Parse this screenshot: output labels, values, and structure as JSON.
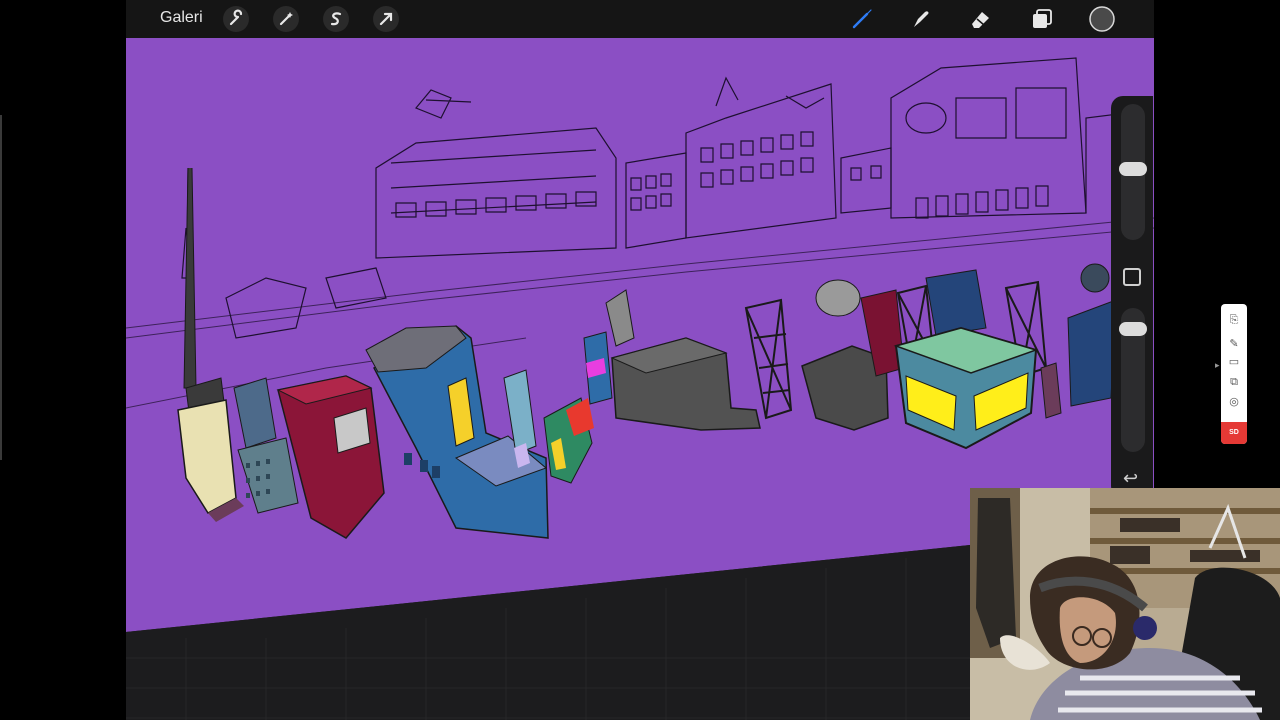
{
  "toolbar": {
    "gallery_label": "Galeri",
    "left_tools": [
      {
        "name": "actions",
        "icon": "wrench-icon"
      },
      {
        "name": "adjustments",
        "icon": "magic-wand-icon"
      },
      {
        "name": "selection",
        "icon": "selection-s-icon"
      },
      {
        "name": "transform",
        "icon": "arrow-cursor-icon"
      }
    ],
    "right_tools": [
      {
        "name": "brush",
        "icon": "brush-icon",
        "active": true
      },
      {
        "name": "smudge",
        "icon": "smudge-icon"
      },
      {
        "name": "eraser",
        "icon": "eraser-icon"
      },
      {
        "name": "layers",
        "icon": "layers-icon"
      },
      {
        "name": "color",
        "icon": "color-swatch-icon"
      }
    ],
    "accent_color": "#2e7cf6",
    "active_color": "#4a4a4a"
  },
  "canvas": {
    "background_color": "#8b4fc4",
    "floor_color": "#1c1c1e"
  },
  "sidebar": {
    "brush_size": 0.55,
    "opacity": 0.92
  },
  "recorder": {
    "record_label": "SD"
  }
}
